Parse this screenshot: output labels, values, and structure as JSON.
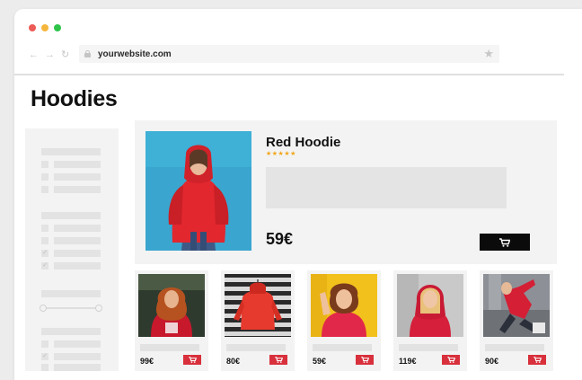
{
  "browser": {
    "url": "yourwebsite.com",
    "nav_icons": [
      "back-arrow-icon",
      "forward-arrow-icon",
      "reload-icon"
    ],
    "bookmark_icon": "star-icon",
    "traffic_light_colors": [
      "#ec5b56",
      "#f4b63c",
      "#2ec44a"
    ]
  },
  "page": {
    "title": "Hoodies"
  },
  "featured": {
    "name": "Red Hoodie",
    "rating_stars": "★★★★★",
    "rating_value": 5,
    "price": "59€",
    "cart_icon": "cart-icon"
  },
  "products": [
    {
      "price": "99€",
      "photo": "woman-curly-hair-red-hoodie-dark-wall"
    },
    {
      "price": "80€",
      "photo": "red-hoodie-on-hanger-striped-wall"
    },
    {
      "price": "59€",
      "photo": "smiling-woman-red-hoodie-yellow-background"
    },
    {
      "price": "119€",
      "photo": "blonde-woman-red-hoodie-grey-wall"
    },
    {
      "price": "90€",
      "photo": "person-jumping-red-hoodie-outdoors"
    }
  ],
  "colors": {
    "accent_red": "#d8303c",
    "star_gold": "#f2a51a",
    "cart_dark": "#0b0b0b"
  }
}
